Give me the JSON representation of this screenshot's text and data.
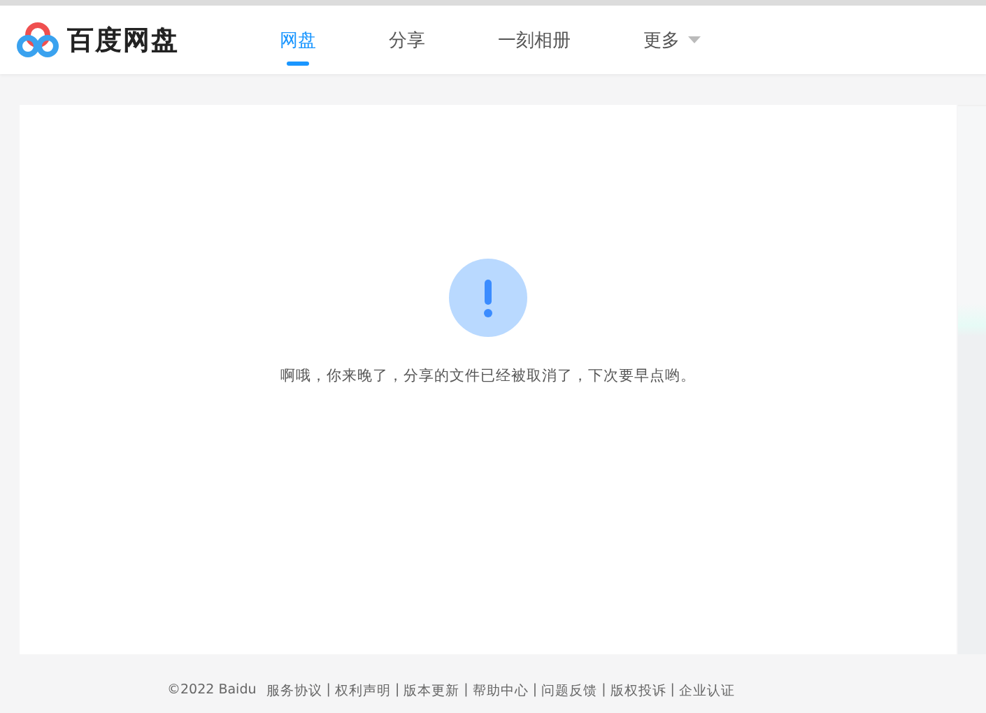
{
  "header": {
    "logo_text": "百度网盘",
    "tabs": [
      {
        "label": "网盘",
        "selected": true,
        "kind": "plain"
      },
      {
        "label": "分享",
        "selected": false,
        "kind": "plain"
      },
      {
        "label": "一刻相册",
        "selected": false,
        "kind": "plain"
      },
      {
        "label": "更多",
        "selected": false,
        "kind": "dropdown"
      }
    ]
  },
  "message": {
    "text": "啊哦，你来晚了，分享的文件已经被取消了，下次要早点哟。"
  },
  "footer": {
    "copyright": "©2022 Baidu",
    "links": [
      "服务协议",
      "权利声明",
      "版本更新",
      "帮助中心",
      "问题反馈",
      "版权投诉",
      "企业认证"
    ],
    "separators": [
      "|",
      "|",
      "|",
      "|",
      "|",
      "|"
    ]
  }
}
